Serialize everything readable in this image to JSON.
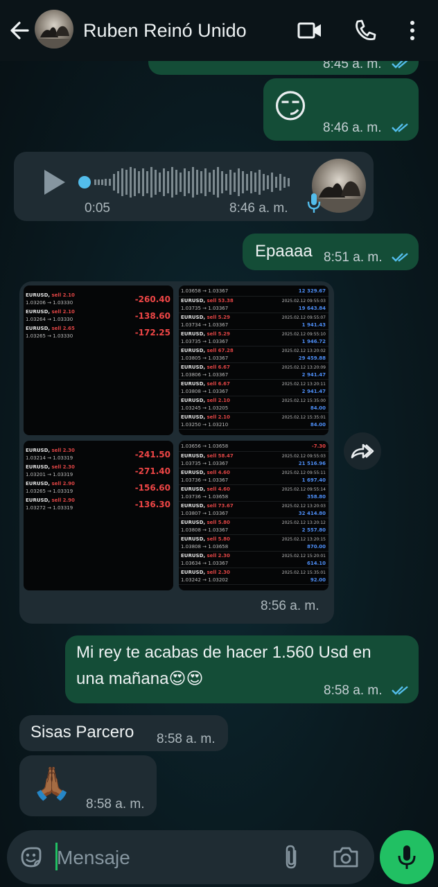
{
  "header": {
    "contact_name": "Ruben Reinó Unido",
    "icons": [
      "back-arrow-icon",
      "video-call-icon",
      "phone-call-icon",
      "more-options-icon"
    ]
  },
  "messages": {
    "top_partial_time": "8:45 a. m.",
    "emoji_msg": {
      "emoji": "😏",
      "time": "8:46 a. m."
    },
    "voice": {
      "duration": "0:05",
      "time": "8:46 a. m."
    },
    "epa": {
      "text": "Epaaaa",
      "time": "8:51 a. m."
    },
    "images": {
      "time": "8:56 a. m."
    },
    "rey": {
      "text": "Mi rey te acabas de hacer 1.560 Usd en una mañana😍😍",
      "time": "8:58 a. m."
    },
    "sisas": {
      "text": "Sisas Parcero",
      "time": "8:58 a. m."
    },
    "pray": {
      "emoji": "🙏🏾",
      "time": "8:58 a. m."
    }
  },
  "input": {
    "placeholder": "Mensaje"
  },
  "colors": {
    "outgoing_bubble": "#144d37",
    "incoming_bubble": "#1f2c33",
    "read_ticks": "#53bdeb",
    "mic_button": "#21c063",
    "profit": "#4d8ef7",
    "loss": "#ef4646"
  },
  "trades": {
    "screen1": [
      {
        "symbol": "EURUSD,",
        "side": "sell 2.10",
        "prices": "1.03206 → 1.03330",
        "result": "-260.40"
      },
      {
        "symbol": "EURUSD,",
        "side": "sell 2.10",
        "prices": "1.03264 → 1.03330",
        "result": "-138.60"
      },
      {
        "symbol": "EURUSD,",
        "side": "sell 2.65",
        "prices": "1.03265 → 1.03330",
        "result": "-172.25"
      }
    ],
    "screen2": [
      {
        "symbol": "EURUSD,",
        "side": "sell 53.38",
        "prices": "1.03735 → 1.03367",
        "date": "2025.02.12 09:55:03",
        "result": "19 643.84"
      },
      {
        "symbol": "EURUSD,",
        "side": "sell 5.29",
        "prices": "1.03734 → 1.03367",
        "date": "2025.02.12 09:55:07",
        "result": "1 941.43"
      },
      {
        "symbol": "EURUSD,",
        "side": "sell 5.29",
        "prices": "1.03735 → 1.03367",
        "date": "2025.02.12 09:55:10",
        "result": "1 946.72"
      },
      {
        "symbol": "EURUSD,",
        "side": "sell 67.28",
        "prices": "1.03805 → 1.03367",
        "date": "2025.02.12 13:20:02",
        "result": "29 459.88"
      },
      {
        "symbol": "EURUSD,",
        "side": "sell 6.67",
        "prices": "1.03806 → 1.03367",
        "date": "2025.02.12 13:20:09",
        "result": "2 941.47"
      },
      {
        "symbol": "EURUSD,",
        "side": "sell 6.67",
        "prices": "1.03808 → 1.03367",
        "date": "2025.02.12 13:20:11",
        "result": "2 941.47"
      },
      {
        "symbol": "EURUSD,",
        "side": "sell 2.10",
        "prices": "1.03245 → 1.03205",
        "date": "2025.02.12 15:35:00",
        "result": "84.00"
      },
      {
        "symbol": "EURUSD,",
        "side": "sell 2.10",
        "prices": "1.03250 → 1.03210",
        "date": "2025.02.12 15:35:01",
        "result": "84.00"
      }
    ],
    "screen2_top": {
      "prices": "1.03658 → 1.03367",
      "result": "12 329.67"
    },
    "screen3": [
      {
        "symbol": "EURUSD,",
        "side": "sell 2.30",
        "prices": "1.03214 → 1.03319",
        "result": "-241.50"
      },
      {
        "symbol": "EURUSD,",
        "side": "sell 2.30",
        "prices": "1.03201 → 1.03319",
        "result": "-271.40"
      },
      {
        "symbol": "EURUSD,",
        "side": "sell 2.90",
        "prices": "1.03265 → 1.03319",
        "result": "-156.60"
      },
      {
        "symbol": "EURUSD,",
        "side": "sell 2.90",
        "prices": "1.03272 → 1.03319",
        "result": "-136.30"
      }
    ],
    "screen4": [
      {
        "symbol": "EURUSD,",
        "side": "sell 58.47",
        "prices": "1.03735 → 1.03367",
        "date": "2025.02.12 09:55:03",
        "result": "21 516.96"
      },
      {
        "symbol": "EURUSD,",
        "side": "sell 4.60",
        "prices": "1.03736 → 1.03367",
        "date": "2025.02.12 09:55:11",
        "result": "1 697.40"
      },
      {
        "symbol": "EURUSD,",
        "side": "sell 4.60",
        "prices": "1.03736 → 1.03658",
        "date": "2025.02.12 09:55:14",
        "result": "358.80"
      },
      {
        "symbol": "EURUSD,",
        "side": "sell 73.67",
        "prices": "1.03807 → 1.03367",
        "date": "2025.02.12 13:20:03",
        "result": "32 414.80"
      },
      {
        "symbol": "EURUSD,",
        "side": "sell 5.80",
        "prices": "1.03808 → 1.03367",
        "date": "2025.02.12 13:20:12",
        "result": "2 557.80"
      },
      {
        "symbol": "EURUSD,",
        "side": "sell 5.80",
        "prices": "1.03808 → 1.03658",
        "date": "2025.02.12 13:20:15",
        "result": "870.00"
      },
      {
        "symbol": "EURUSD,",
        "side": "sell 2.30",
        "prices": "1.03634 → 1.03367",
        "date": "2025.02.12 15:20:01",
        "result": "614.10"
      },
      {
        "symbol": "EURUSD,",
        "side": "sell 2.30",
        "prices": "1.03242 → 1.03202",
        "date": "2025.02.12 15:35:01",
        "result": "92.00"
      }
    ],
    "screen4_top": {
      "prices": "1.03656 → 1.03658",
      "result": "-7.30"
    }
  }
}
